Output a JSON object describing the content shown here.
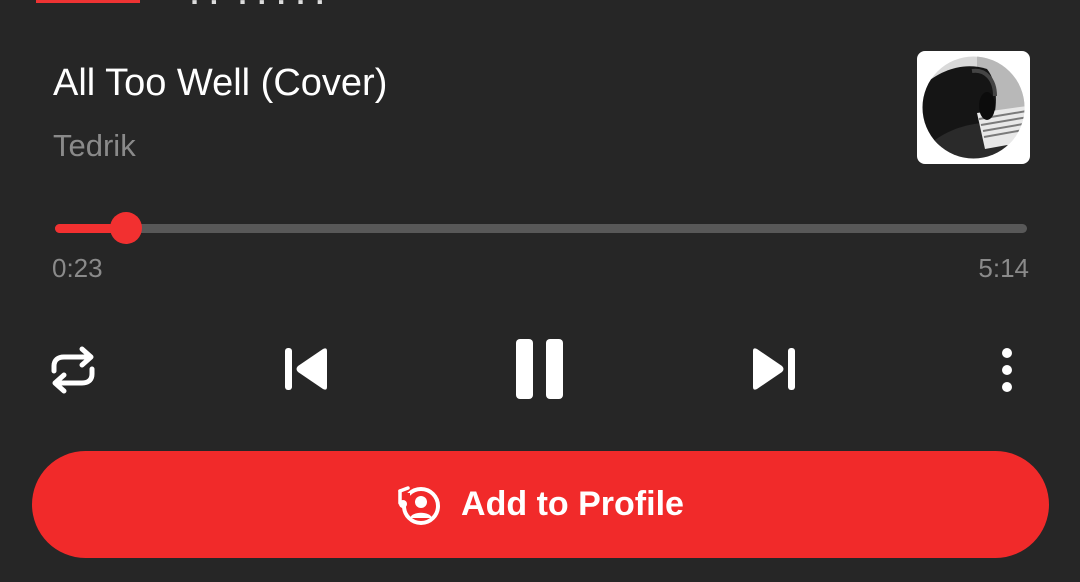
{
  "top": {
    "cut_text": "?? ?????"
  },
  "track": {
    "title": "All Too Well (Cover)",
    "artist": "Tedrik"
  },
  "player": {
    "elapsed": "0:23",
    "total": "5:14",
    "progress_fraction": 0.073
  },
  "controls": {
    "repeat": "repeat-icon",
    "previous": "skip-previous-icon",
    "pause": "pause-icon",
    "next": "skip-next-icon",
    "more": "more-vertical-icon"
  },
  "action": {
    "label": "Add to Profile",
    "icon": "add-to-profile-icon"
  },
  "colors": {
    "background": "#262626",
    "accent": "#f12a2a",
    "secondary_text": "#8a8a8a",
    "track": "#585858"
  }
}
